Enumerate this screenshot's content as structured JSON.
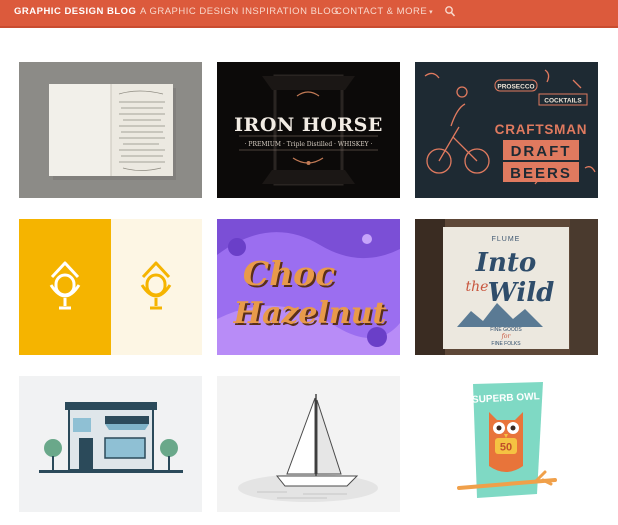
{
  "nav": {
    "brand": "GRAPHIC DESIGN BLOG",
    "tagline": "A GRAPHIC DESIGN INSPIRATION BLOG",
    "contact": "CONTACT & MORE",
    "contact_caret": "▾",
    "search_icon": "search-icon"
  },
  "colors": {
    "header": "#dc5a3c",
    "accent_orange": "#e07048"
  },
  "tiles": [
    {
      "name": "sketchbook",
      "bg": "#8c8b87"
    },
    {
      "name": "iron-horse",
      "title": "IRON HORSE",
      "subtitle": "· PREMIUM · Triple Distilled · WHISKEY ·",
      "bg": "#0c0a09"
    },
    {
      "name": "craftsman",
      "prosecco": "PROSECCO",
      "cocktails": "COCKTAILS",
      "craftsman": "CRAFTSMAN",
      "draft": "DRAFT",
      "beers": "BEERS",
      "bg": "#1e2a33"
    },
    {
      "name": "mic-logo",
      "bg_left": "#f5b400",
      "bg_right": "#fdf6e4"
    },
    {
      "name": "choc-hazelnut",
      "line1": "Choc",
      "line2": "Hazelnut",
      "bg": "#9b6ef0"
    },
    {
      "name": "into-the-wild",
      "flume": "FLUME",
      "into": "Into",
      "the": "the",
      "wild": "Wild",
      "tagline1": "FINE GOODS",
      "tagline2": "FINE FOLKS",
      "for": "for"
    },
    {
      "name": "storefront",
      "bg": "#f1f2f3"
    },
    {
      "name": "sailboat",
      "bg": "#f3f3f3"
    },
    {
      "name": "superb-owl",
      "title": "SUPERB OWL",
      "number": "50",
      "bg": "#ffffff"
    }
  ]
}
